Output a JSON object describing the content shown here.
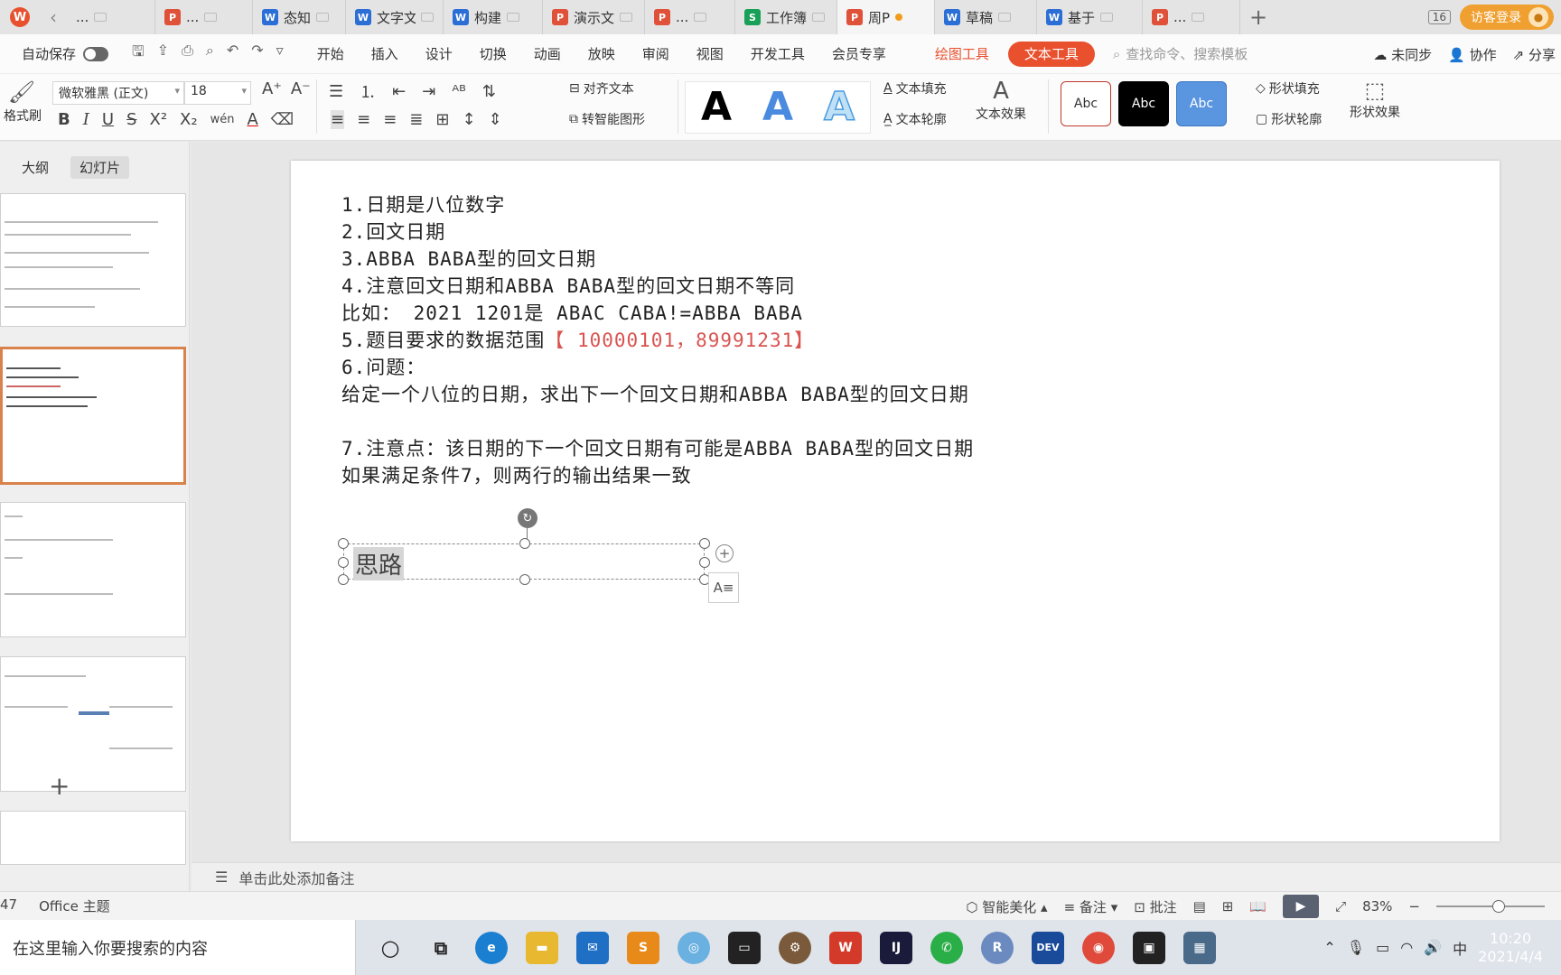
{
  "tabbar": {
    "tabs": [
      {
        "label": "...",
        "type": "blank"
      },
      {
        "label": "...",
        "type": "p"
      },
      {
        "label": "态知",
        "type": "w"
      },
      {
        "label": "文字文",
        "type": "w"
      },
      {
        "label": "构建",
        "type": "w"
      },
      {
        "label": "演示文",
        "type": "p"
      },
      {
        "label": "...",
        "type": "p"
      },
      {
        "label": "工作簿",
        "type": "s"
      },
      {
        "label": "周P",
        "type": "p",
        "active": true
      },
      {
        "label": "草稿",
        "type": "w"
      },
      {
        "label": "基于",
        "type": "w"
      },
      {
        "label": "...",
        "type": "p"
      }
    ],
    "add_label": "+",
    "window_num": "16",
    "login_label": "访客登录"
  },
  "menubar": {
    "autosave_label": "自动保存",
    "items": [
      "开始",
      "插入",
      "设计",
      "切换",
      "动画",
      "放映",
      "审阅",
      "视图",
      "开发工具",
      "会员专享"
    ],
    "draw_tools_label": "绘图工具",
    "text_tools_label": "文本工具",
    "search_placeholder": "查找命令、搜索模板",
    "unsync_label": "未同步",
    "collab_label": "协作",
    "share_label": "分享"
  },
  "ribbon": {
    "format_brush_label": "格式刷",
    "font_name": "微软雅黑 (正文)",
    "font_size": "18",
    "align_text_label": "对齐文本",
    "smart_shape_label": "转智能图形",
    "text_fill_label": "文本填充",
    "text_outline_label": "文本轮廓",
    "text_effect_label": "文本效果",
    "shape_fill_label": "形状填充",
    "shape_outline_label": "形状轮廓",
    "shape_effect_label": "形状效果",
    "style_sample": "Abc",
    "wen_label": "wén"
  },
  "leftpanel": {
    "tab_outline": "大纲",
    "tab_slides": "幻灯片",
    "add_label": "+"
  },
  "slide": {
    "lines": [
      {
        "text": "1.日期是八位数字"
      },
      {
        "text": "2.回文日期"
      },
      {
        "text": "3.ABBA BABA型的回文日期"
      },
      {
        "text": "4.注意回文日期和ABBA BABA型的回文日期不等同"
      },
      {
        "text": "比如： 2021 1201是 ABAC CABA!=ABBA BABA"
      },
      {
        "text": "5.题目要求的数据范围",
        "highlight": "【 10000101，89991231】"
      },
      {
        "text": "6.问题："
      },
      {
        "text": "给定一个八位的日期，求出下一个回文日期和ABBA BABA型的回文日期"
      },
      {
        "text": ""
      },
      {
        "text": "7.注意点：该日期的下一个回文日期有可能是ABBA BABA型的回文日期"
      },
      {
        "text": "如果满足条件7，则两行的输出结果一致"
      }
    ],
    "textbox_text": "思路"
  },
  "notes": {
    "placeholder": "单击此处添加备注"
  },
  "statusbar": {
    "slide_count": "47",
    "theme": "Office 主题",
    "beautify_label": "智能美化",
    "notes_label": "备注",
    "comment_label": "批注",
    "zoom": "83%"
  },
  "taskbar": {
    "search_placeholder": "在这里输入你要搜索的内容",
    "ime_label": "中",
    "time": "10:20",
    "date": "2021/4/4"
  },
  "colors": {
    "accent": "#e8502e",
    "highlight_text": "#d9534f",
    "selected_thumb_border": "#d9824b"
  }
}
